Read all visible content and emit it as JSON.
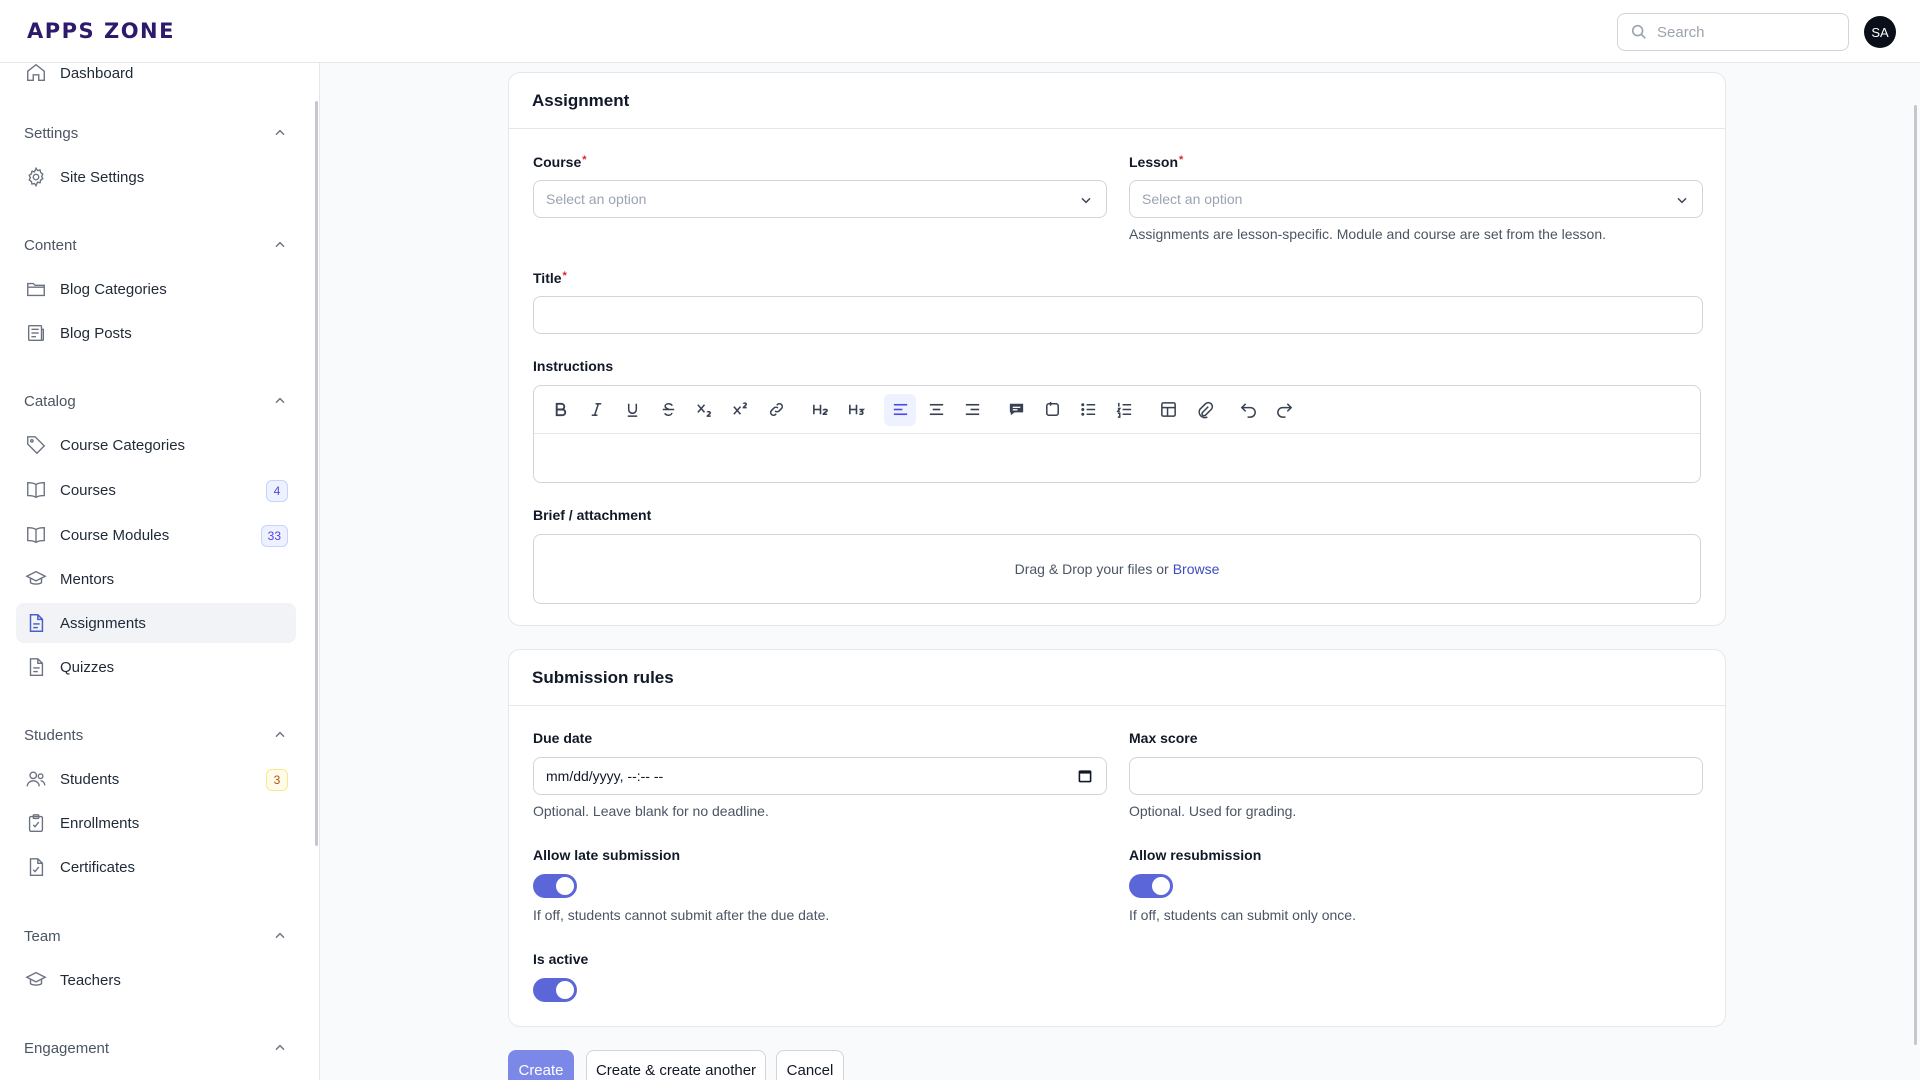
{
  "header": {
    "logo": "APPS ZONE",
    "search_placeholder": "Search",
    "avatar_initials": "SA"
  },
  "sidebar": {
    "partial_item": "Dashboard",
    "groups": [
      {
        "label": "Settings",
        "items": [
          {
            "label": "Site Settings",
            "icon": "gear-icon"
          }
        ]
      },
      {
        "label": "Content",
        "items": [
          {
            "label": "Blog Categories",
            "icon": "folder-icon"
          },
          {
            "label": "Blog Posts",
            "icon": "newspaper-icon"
          }
        ]
      },
      {
        "label": "Catalog",
        "items": [
          {
            "label": "Course Categories",
            "icon": "tag-icon"
          },
          {
            "label": "Courses",
            "icon": "book-icon",
            "badge": "4"
          },
          {
            "label": "Course Modules",
            "icon": "book-icon",
            "badge": "33"
          },
          {
            "label": "Mentors",
            "icon": "academic-cap-icon"
          },
          {
            "label": "Assignments",
            "icon": "document-icon",
            "active": true
          },
          {
            "label": "Quizzes",
            "icon": "document-icon"
          }
        ]
      },
      {
        "label": "Students",
        "items": [
          {
            "label": "Students",
            "icon": "users-icon",
            "badge": "3"
          },
          {
            "label": "Enrollments",
            "icon": "clipboard-check-icon"
          },
          {
            "label": "Certificates",
            "icon": "document-check-icon"
          }
        ]
      },
      {
        "label": "Team",
        "items": [
          {
            "label": "Teachers",
            "icon": "academic-cap-icon"
          }
        ]
      },
      {
        "label": "Engagement",
        "items": []
      }
    ]
  },
  "assignment": {
    "heading": "Assignment",
    "course_label": "Course",
    "course_placeholder": "Select an option",
    "lesson_label": "Lesson",
    "lesson_placeholder": "Select an option",
    "lesson_help": "Assignments are lesson-specific. Module and course are set from the lesson.",
    "title_label": "Title",
    "title_value": "",
    "instructions_label": "Instructions",
    "attachment_label": "Brief / attachment",
    "drop_text": "Drag & Drop your files or",
    "browse_text": "Browse"
  },
  "submission": {
    "heading": "Submission rules",
    "due_label": "Due date",
    "due_value": "mm/dd/yyyy, --:-- --",
    "due_help": "Optional. Leave blank for no deadline.",
    "max_label": "Max score",
    "max_value": "",
    "max_help": "Optional. Used for grading.",
    "late_label": "Allow late submission",
    "late_on": true,
    "late_help": "If off, students cannot submit after the due date.",
    "resub_label": "Allow resubmission",
    "resub_on": true,
    "resub_help": "If off, students can submit only once.",
    "active_label": "Is active",
    "active_on": true
  },
  "actions": {
    "create": "Create",
    "create_another": "Create & create another",
    "cancel": "Cancel"
  },
  "colors": {
    "accent": "#5b67d8",
    "primary_button": "#7b88e8",
    "logo": "#2e1a6b"
  }
}
